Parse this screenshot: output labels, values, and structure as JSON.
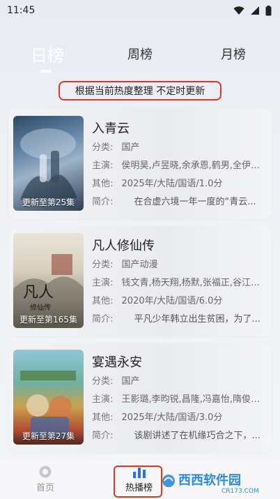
{
  "status_bar": {
    "time": "11:45"
  },
  "tabs": [
    {
      "label": "日榜",
      "active": true
    },
    {
      "label": "周榜",
      "active": false
    },
    {
      "label": "月榜",
      "active": false
    }
  ],
  "notice": "根据当前热度整理 不定时更新",
  "labels": {
    "category": "分类:",
    "cast": "主演:",
    "other": "其他:",
    "intro": "简介:"
  },
  "shows": [
    {
      "title": "入青云",
      "category": "国产",
      "cast": "侯明昊,卢昱晓,余承恩,鹤男,全伊伦,...",
      "other": "2025年/大陆/国语/1.0分",
      "intro": "在合虚六境一年一度的“青云...",
      "poster_caption": "更新至第25集"
    },
    {
      "title": "凡人修仙传",
      "category": "国产动漫",
      "cast": "钱文青,杨天翔,杨默,张福正,谷江山,...",
      "other": "2020年/大陆/国语/6.0分",
      "intro": "平凡少年韩立出生贫困，为了...",
      "poster_caption": "更新至第165集"
    },
    {
      "title": "宴遇永安",
      "category": "国产",
      "cast": "王影璐,李昀锐,昌隆,冯嘉怡,隋俊波,...",
      "other": "2025年/大陆/国语/3.0分",
      "intro": "该剧讲述了在机缘巧合之下，...",
      "poster_caption": "更新至第27集"
    }
  ],
  "bottom_nav": [
    {
      "label": "首页",
      "icon": "home-icon"
    },
    {
      "label": "热播榜",
      "icon": "chart-icon"
    }
  ],
  "watermark": {
    "text": "西西软件园",
    "url": "CR173.COM"
  }
}
